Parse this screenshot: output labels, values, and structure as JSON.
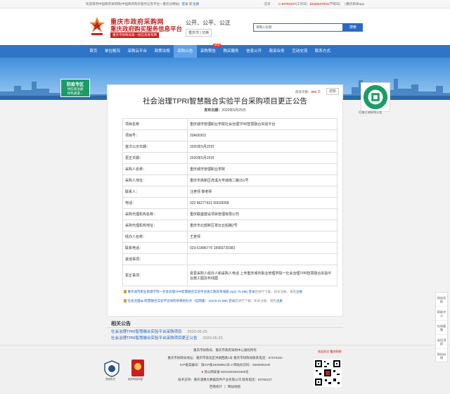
{
  "topbar": {
    "welcome": "欢迎来到中国政府采购网(中国政府购买服务信息平台—重庆分网站)",
    "login": "登录",
    "or": "或",
    "register": "注册",
    "home": "首页",
    "phone_work": "63782227",
    "phone_work_label": "(工作日)",
    "phone_holiday": "18183107931",
    "phone_holiday_label": "(节假日)",
    "app": "重庆政采app"
  },
  "header": {
    "logo_line1": "重庆市政府采购网",
    "logo_line2": "重庆政府购买服务信息平台",
    "logo_line3": "重庆市财政局第一批信息发布网",
    "slogan": "公开、公平、公正",
    "region": "重庆市 | 切换",
    "search_placeholder": "请输入标题",
    "search_button": "搜索"
  },
  "nav": {
    "items": [
      {
        "label": "首页"
      },
      {
        "label": "单位概况"
      },
      {
        "label": "采购云平台"
      },
      {
        "label": "政策法规"
      },
      {
        "label": "采购公告"
      },
      {
        "label": "采购预告",
        "badge": "NEW"
      },
      {
        "label": "购买服务"
      },
      {
        "label": "信息公开"
      },
      {
        "label": "政采业务"
      },
      {
        "label": "互动交流"
      },
      {
        "label": "联系方式"
      }
    ],
    "active_index": 4
  },
  "side_ad": {
    "line1": "防疫专区",
    "line2": "供应商注册",
    "line3": "绿色通道→"
  },
  "side_qr_label": "扫描订阅采购公告",
  "article": {
    "read_label": "阅读次数：",
    "read_count": "858",
    "read_unit": "次",
    "print": "打印",
    "title": "社会治理TPRI智慧融合实验平台采购项目更正公告",
    "date_label": "发布日期：",
    "date": "2020年5月25日",
    "rows": [
      {
        "k": "项目名称",
        "v": "重庆城市管理职业学院社会治理TPRI智慧融合实验平台"
      },
      {
        "k": "项目号：",
        "v": "20A00303"
      },
      {
        "k": "首次公示日期：",
        "v": "2020年5月25日"
      },
      {
        "k": "更正日期：",
        "v": "2020年5月25日"
      },
      {
        "k": "采购人名称：",
        "v": "重庆城市管理职业学院"
      },
      {
        "k": "采购人地址：",
        "v": "重庆市高新区虎溪大学城南二路151号"
      },
      {
        "k": "联系人：",
        "v": "汪老师 黎老师"
      },
      {
        "k": "电话：",
        "v": "023 86277421 65626068"
      },
      {
        "k": "采购代理机构名称：",
        "v": "重庆联盛建设项目管理有限公司"
      },
      {
        "k": "采购代理机构地址：",
        "v": "重庆市北部新区翠云云柏路2号"
      },
      {
        "k": "经办人名称：",
        "v": "王老师"
      },
      {
        "k": "联系电话：",
        "v": "023-61896770 18983739383"
      },
      {
        "k": "其他事项：",
        "v": ""
      },
      {
        "k": "更正事项：",
        "v": "变更采购人经办人和采购人电话 上传重庆城市职业管理学院一社会治理TPR智慧融合实验平台施工图及布线图"
      }
    ],
    "attachments": [
      {
        "name": "重庆城市职业管理学院一社会治理TPR智慧融合实验平台施工图及布线图.zip(2.75 MB)",
        "login": "登录",
        "tail": "后进行下载，如未注册，请先",
        "register": "注册"
      },
      {
        "name": "社会治理tpri智慧融合实验平台采购项目招标文（挂网版）.doc(8.24 MB)",
        "login": "登录",
        "tail": "后进行下载，如未注册，请先",
        "register": "注册"
      }
    ]
  },
  "related": {
    "title": "相关公告",
    "items": [
      {
        "title": "社会治理TPRI智慧融合实验平台采购项目",
        "date": "2020-05-25"
      },
      {
        "title": "社会治理TPRI智慧融合实验平台采购项目更正公告",
        "date": "2020-05-25"
      }
    ]
  },
  "footer": {
    "line1": "重庆市财政局、重庆市政府采购中心版权所有",
    "line2": "重庆市财政局地址：重庆市渝北区洪湖西路1号  重庆市财政局联系电话：67575332",
    "line3": "ICP备案编号：渝ICP备19008961号-2  网站标识码：5000000100",
    "line4": "渝公网安备 50019002501906号",
    "line5": "技术支持：重庆浦惠大数据软件产业有限公司  联系电话：63782227",
    "link1": "西南统计",
    "sep": "|",
    "link2": "网站地图",
    "emblem1_label": "党政机关",
    "emblem2_label": "政府网站找错",
    "qr_label": "欢迎关注\"重庆财政\""
  },
  "right_float": [
    "网站导航",
    "帮助中心",
    "在线客服",
    "返回顶部",
    "网站纠错"
  ]
}
